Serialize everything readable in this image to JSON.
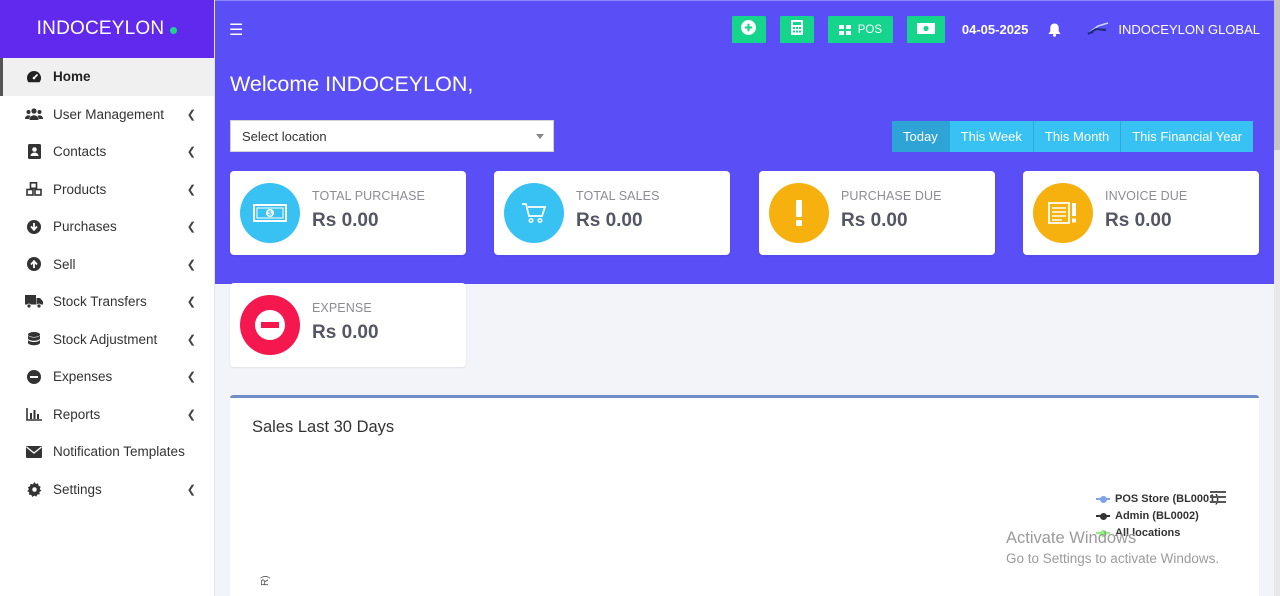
{
  "brand": {
    "name": "INDOCEYLON"
  },
  "sidebar": {
    "items": [
      {
        "label": "Home",
        "icon": "dashboard-icon",
        "active": true
      },
      {
        "label": "User Management",
        "icon": "users-icon"
      },
      {
        "label": "Contacts",
        "icon": "contacts-icon"
      },
      {
        "label": "Products",
        "icon": "cubes-icon"
      },
      {
        "label": "Purchases",
        "icon": "arrow-circle-down-icon"
      },
      {
        "label": "Sell",
        "icon": "arrow-circle-up-icon"
      },
      {
        "label": "Stock Transfers",
        "icon": "truck-icon"
      },
      {
        "label": "Stock Adjustment",
        "icon": "database-icon"
      },
      {
        "label": "Expenses",
        "icon": "minus-circle-icon"
      },
      {
        "label": "Reports",
        "icon": "bar-chart-icon"
      },
      {
        "label": "Notification Templates",
        "icon": "envelope-icon"
      },
      {
        "label": "Settings",
        "icon": "gear-icon"
      }
    ]
  },
  "header": {
    "pos_label": "POS",
    "date": "04-05-2025",
    "user_name": "INDOCEYLON GLOBAL"
  },
  "main": {
    "welcome": "Welcome INDOCEYLON,",
    "location_placeholder": "Select location",
    "filters": [
      "Today",
      "This Week",
      "This Month",
      "This Financial Year"
    ],
    "active_filter": "Today",
    "cards": [
      {
        "title": "TOTAL PURCHASE",
        "value": "Rs 0.00",
        "color": "#38c2f4",
        "icon": "money-icon"
      },
      {
        "title": "TOTAL SALES",
        "value": "Rs 0.00",
        "color": "#38c2f4",
        "icon": "cart-icon"
      },
      {
        "title": "PURCHASE DUE",
        "value": "Rs 0.00",
        "color": "#f6b10f",
        "icon": "exclamation-icon"
      },
      {
        "title": "INVOICE DUE",
        "value": "Rs 0.00",
        "color": "#f6b10f",
        "icon": "invoice-icon"
      },
      {
        "title": "EXPENSE",
        "value": "Rs 0.00",
        "color": "#f5184f",
        "icon": "minus-circle-icon"
      }
    ],
    "chart": {
      "title": "Sales Last 30 Days",
      "legend": [
        {
          "name": "POS Store (BL0001)",
          "color": "#7fa3e6"
        },
        {
          "name": "Admin (BL0002)",
          "color": "#333333"
        },
        {
          "name": "All locations",
          "color": "#8ef07f"
        }
      ],
      "ylabel_fragment": "R)"
    }
  },
  "watermark": {
    "line1": "Activate Windows",
    "line2": "Go to Settings to activate Windows."
  },
  "colors": {
    "primary": "#5a4ff7",
    "brand_bg": "#6128ee",
    "success": "#15d48c"
  }
}
